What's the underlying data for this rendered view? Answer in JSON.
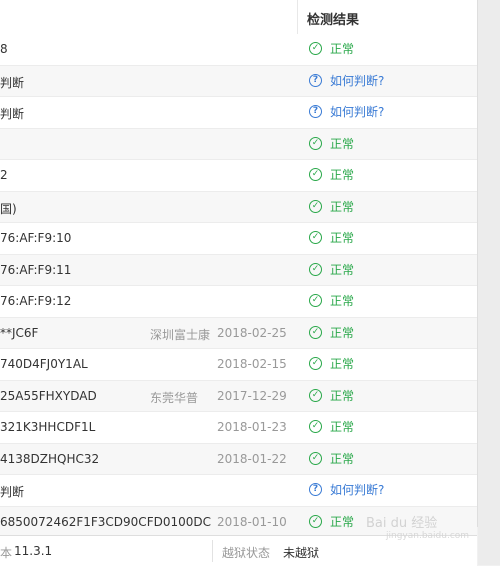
{
  "header": {
    "result_title": "检测结果"
  },
  "rows": [
    {
      "value": "8",
      "vendor": "",
      "date": "",
      "status": "ok",
      "result": "正常"
    },
    {
      "value": "判断",
      "vendor": "",
      "date": "",
      "status": "judge",
      "result": "如何判断?"
    },
    {
      "value": "判断",
      "vendor": "",
      "date": "",
      "status": "judge",
      "result": "如何判断?"
    },
    {
      "value": "",
      "vendor": "",
      "date": "",
      "status": "ok",
      "result": "正常"
    },
    {
      "value": "2",
      "vendor": "",
      "date": "",
      "status": "ok",
      "result": "正常"
    },
    {
      "value": "国)",
      "vendor": "",
      "date": "",
      "status": "ok",
      "result": "正常"
    },
    {
      "value": "76:AF:F9:10",
      "vendor": "",
      "date": "",
      "status": "ok",
      "result": "正常"
    },
    {
      "value": "76:AF:F9:11",
      "vendor": "",
      "date": "",
      "status": "ok",
      "result": "正常"
    },
    {
      "value": "76:AF:F9:12",
      "vendor": "",
      "date": "",
      "status": "ok",
      "result": "正常"
    },
    {
      "value": "**JC6F",
      "vendor": "深圳富士康",
      "date": "2018-02-25",
      "status": "ok",
      "result": "正常"
    },
    {
      "value": "740D4FJ0Y1AL",
      "vendor": "",
      "date": "2018-02-15",
      "status": "ok",
      "result": "正常"
    },
    {
      "value": "25A55FHXYDAD",
      "vendor": "东莞华普",
      "date": "2017-12-29",
      "status": "ok",
      "result": "正常"
    },
    {
      "value": "321K3HHCDF1L",
      "vendor": "",
      "date": "2018-01-23",
      "status": "ok",
      "result": "正常"
    },
    {
      "value": "4138DZHQHC32",
      "vendor": "",
      "date": "2018-01-22",
      "status": "ok",
      "result": "正常"
    },
    {
      "value": "判断",
      "vendor": "",
      "date": "",
      "status": "judge",
      "result": "如何判断?"
    },
    {
      "value": "6850072462F1F3CD90CFD0100DC",
      "vendor": "",
      "date": "2018-01-10",
      "status": "ok",
      "result": "正常"
    }
  ],
  "footer": {
    "version_label": "本",
    "version": "11.3.1",
    "jailbreak_label": "越狱状态",
    "jailbreak_value": "未越狱"
  },
  "watermark": {
    "text": "Bai du 经验",
    "sub": "jingyan.baidu.com"
  },
  "colors": {
    "ok": "#2aa84a",
    "judge": "#3a7bd5"
  }
}
